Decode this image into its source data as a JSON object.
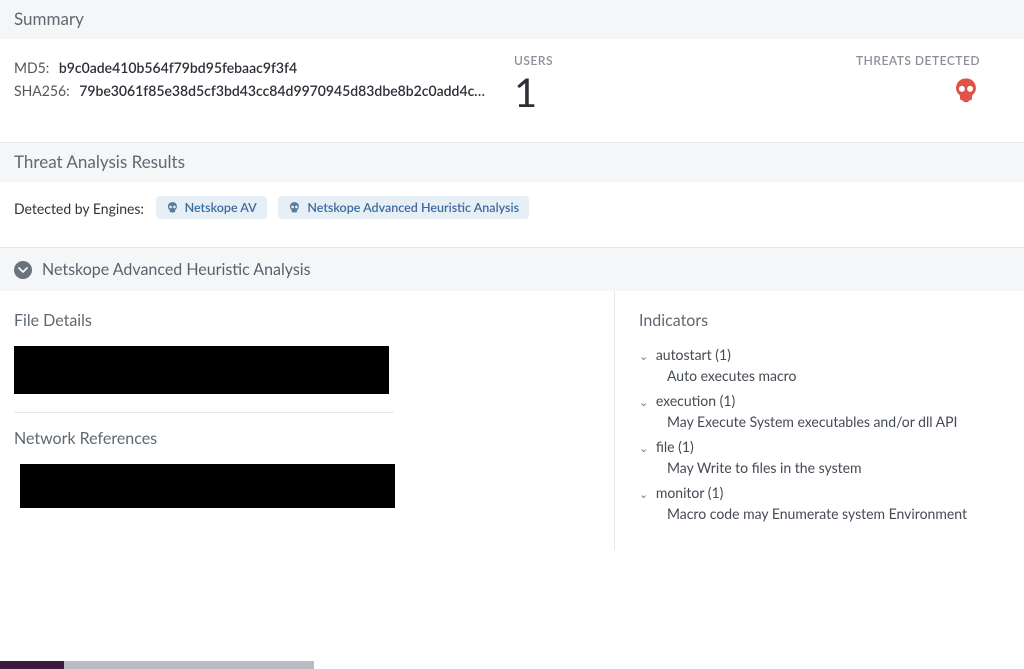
{
  "summary": {
    "title": "Summary",
    "md5_label": "MD5:",
    "md5_value": "b9c0ade410b564f79bd95febaac9f3f4",
    "sha256_label": "SHA256:",
    "sha256_value": "79be3061f85e38d5cf3bd43cc84d9970945d83dbe8b2c0add4c…",
    "users_label": "USERS",
    "users_value": "1",
    "threats_label": "THREATS DETECTED",
    "skull_color": "#e0534a"
  },
  "threat_analysis": {
    "title": "Threat Analysis Results",
    "detected_label": "Detected by Engines:",
    "engines": [
      {
        "label": "Netskope AV"
      },
      {
        "label": "Netskope Advanced Heuristic Analysis"
      }
    ]
  },
  "heuristic": {
    "title": "Netskope Advanced Heuristic Analysis",
    "file_details_title": "File Details",
    "network_refs_title": "Network References",
    "indicators_title": "Indicators",
    "indicators": [
      {
        "group": "autostart (1)",
        "item": "Auto executes macro"
      },
      {
        "group": "execution (1)",
        "item": "May Execute System executables and/or dll API"
      },
      {
        "group": "file (1)",
        "item": "May Write to files in the system"
      },
      {
        "group": "monitor (1)",
        "item": "Macro code may Enumerate system Environment"
      }
    ]
  }
}
